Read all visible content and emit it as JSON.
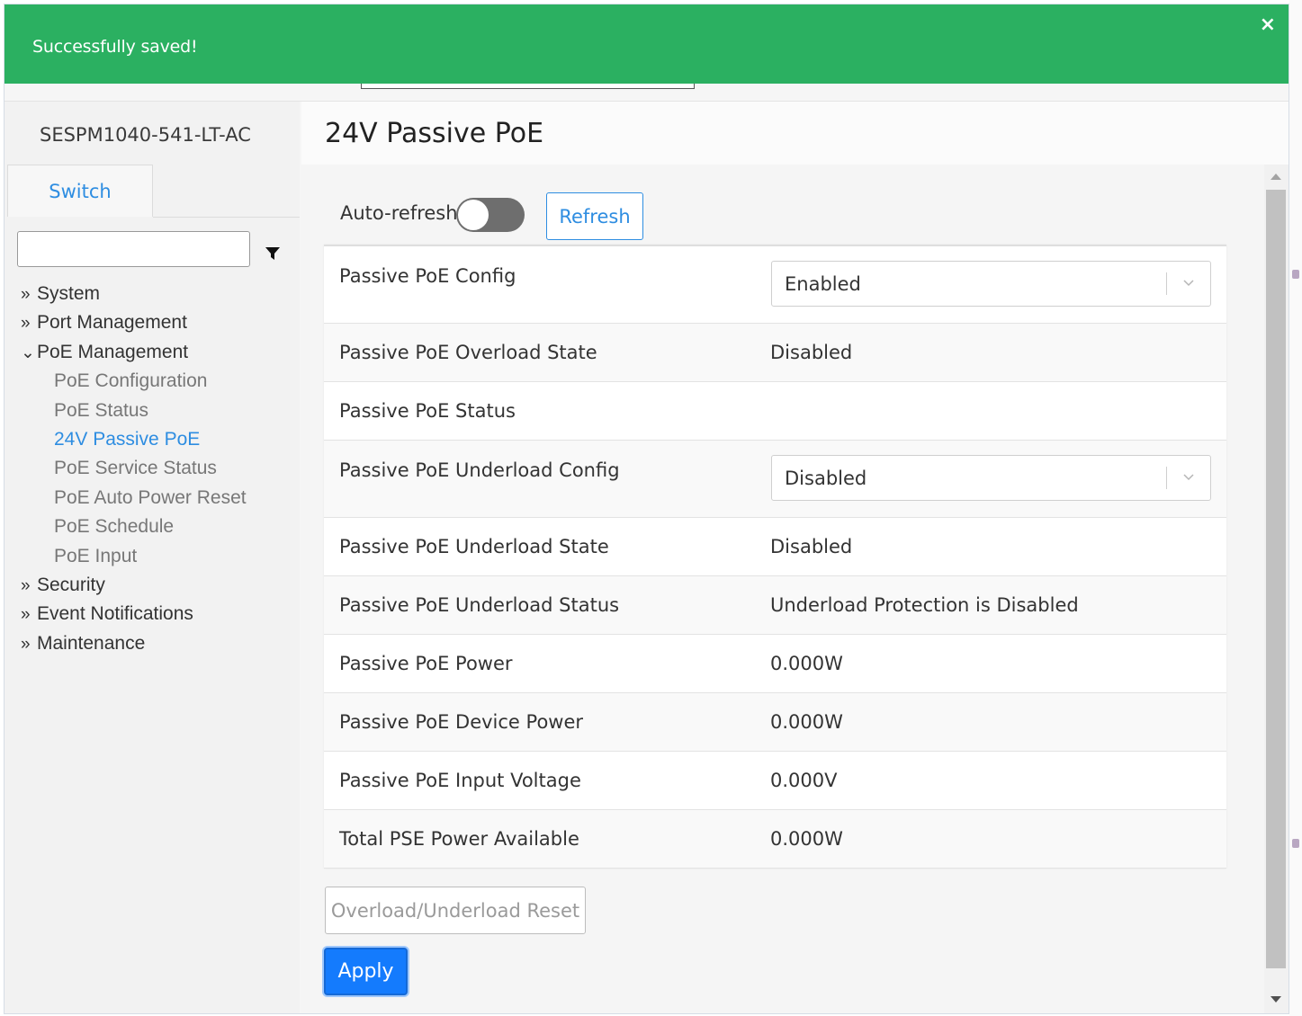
{
  "toast": {
    "message": "Successfully saved!",
    "close_glyph": "×",
    "color": "#2bb061"
  },
  "sidebar": {
    "device_name": "SESPM1040-541-LT-AC",
    "tab": "Switch",
    "filter_value": "",
    "items": [
      {
        "label": "System",
        "prefix": "»",
        "level": 0
      },
      {
        "label": "Port Management",
        "prefix": "»",
        "level": 0
      },
      {
        "label": "PoE Management",
        "prefix": "⌄",
        "level": 0
      },
      {
        "label": "PoE Configuration",
        "prefix": "",
        "level": 1
      },
      {
        "label": "PoE Status",
        "prefix": "",
        "level": 1
      },
      {
        "label": "24V Passive PoE",
        "prefix": "",
        "level": 1,
        "active": true
      },
      {
        "label": "PoE Service Status",
        "prefix": "",
        "level": 1
      },
      {
        "label": "PoE Auto Power Reset",
        "prefix": "",
        "level": 1
      },
      {
        "label": "PoE Schedule",
        "prefix": "",
        "level": 1
      },
      {
        "label": "PoE Input",
        "prefix": "",
        "level": 1
      },
      {
        "label": "Security",
        "prefix": "»",
        "level": 0
      },
      {
        "label": "Event Notifications",
        "prefix": "»",
        "level": 0
      },
      {
        "label": "Maintenance",
        "prefix": "»",
        "level": 0
      }
    ]
  },
  "main": {
    "title": "24V Passive PoE",
    "auto_refresh_label": "Auto-refresh",
    "auto_refresh_on": false,
    "refresh_label": "Refresh",
    "rows": [
      {
        "label": "Passive PoE Config",
        "value": "Enabled",
        "type": "select"
      },
      {
        "label": "Passive PoE Overload State",
        "value": "Disabled",
        "type": "text"
      },
      {
        "label": "Passive PoE Status",
        "value": "",
        "type": "text"
      },
      {
        "label": "Passive PoE Underload Config",
        "value": "Disabled",
        "type": "select"
      },
      {
        "label": "Passive PoE Underload State",
        "value": "Disabled",
        "type": "text"
      },
      {
        "label": "Passive PoE Underload Status",
        "value": "Underload Protection is Disabled",
        "type": "text"
      },
      {
        "label": "Passive PoE Power",
        "value": "0.000W",
        "type": "text"
      },
      {
        "label": "Passive PoE Device Power",
        "value": "0.000W",
        "type": "text"
      },
      {
        "label": "Passive PoE Input Voltage",
        "value": "0.000V",
        "type": "text"
      },
      {
        "label": "Total PSE Power Available",
        "value": "0.000W",
        "type": "text"
      }
    ],
    "reset_label": "Overload/Underload Reset",
    "apply_label": "Apply",
    "accent_color": "#2e8de1",
    "apply_color": "#147bfd"
  }
}
